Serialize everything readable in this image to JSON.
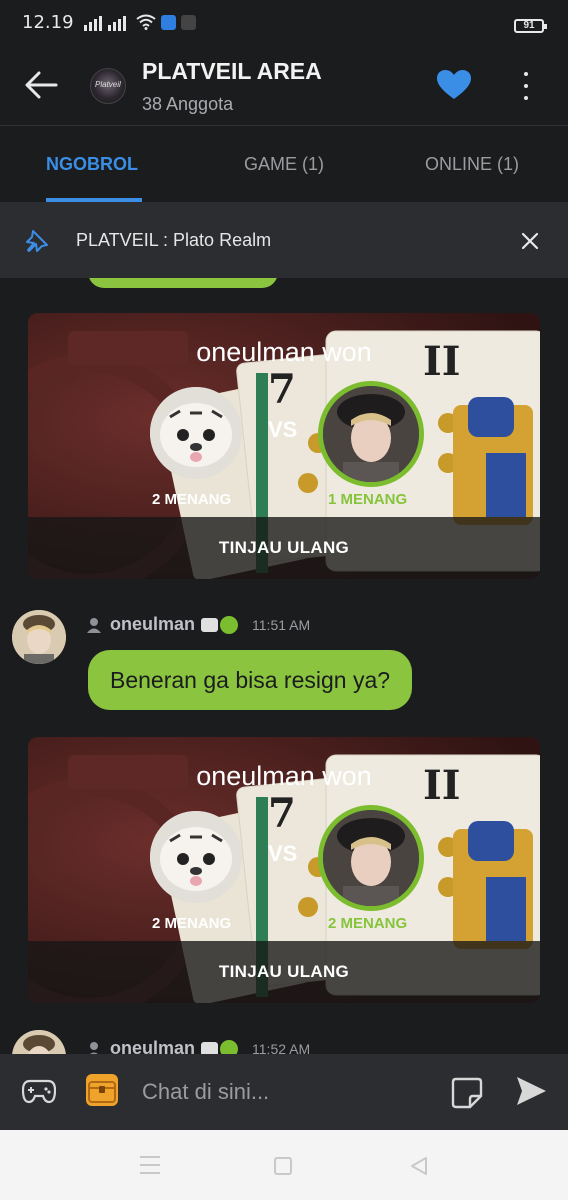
{
  "status_bar": {
    "time": "12.19",
    "battery": "91"
  },
  "header": {
    "title": "PLATVEIL AREA",
    "subtitle": "38 Anggota",
    "avatar_text": "Platveil",
    "accent_color": "#3a8ee6"
  },
  "tabs": [
    {
      "label": "NGOBROL",
      "active": true
    },
    {
      "label": "GAME (1)",
      "active": false
    },
    {
      "label": "ONLINE (1)",
      "active": false
    }
  ],
  "pinned": {
    "text": "PLATVEIL : Plato Realm"
  },
  "games": [
    {
      "won_text": "oneulman won",
      "vs": "VS",
      "player1_wins": "2 MENANG",
      "player2_wins": "1 MENANG",
      "review_label": "TINJAU ULANG"
    },
    {
      "won_text": "oneulman won",
      "vs": "VS",
      "player1_wins": "2 MENANG",
      "player2_wins": "2 MENANG",
      "review_label": "TINJAU ULANG"
    }
  ],
  "messages": [
    {
      "username": "oneulman",
      "time": "11:51 AM",
      "text": "Beneran ga bisa resign ya?"
    },
    {
      "username": "oneulman",
      "time": "11:52 AM"
    }
  ],
  "input": {
    "placeholder": "Chat di sini..."
  },
  "colors": {
    "bubble": "#8bc540",
    "winner_ring": "#7bbd2e",
    "background": "#1b1c1e"
  }
}
